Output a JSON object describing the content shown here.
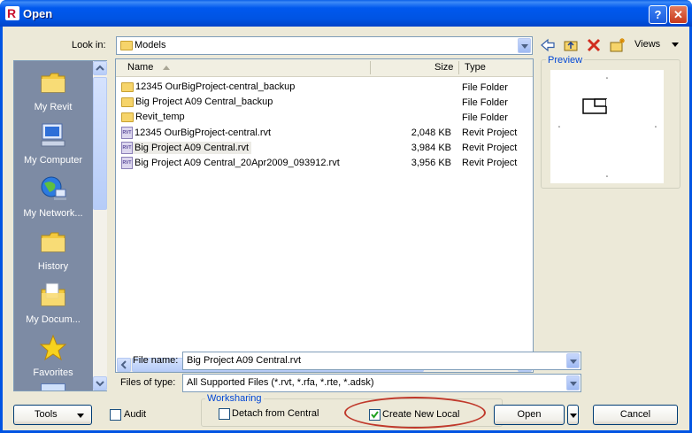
{
  "window": {
    "title": "Open",
    "help_glyph": "?",
    "close_glyph": "✕"
  },
  "look_in": {
    "label": "Look in:",
    "value": "Models"
  },
  "toolbar": {
    "back_icon": "back-arrow-icon",
    "up_icon": "up-folder-icon",
    "delete_icon": "delete-icon",
    "new_folder_icon": "new-folder-icon",
    "views_label": "Views"
  },
  "places": [
    {
      "label": "My Revit",
      "icon": "folder-icon"
    },
    {
      "label": "My Computer",
      "icon": "computer-icon"
    },
    {
      "label": "My Network...",
      "icon": "network-icon"
    },
    {
      "label": "History",
      "icon": "folder-icon"
    },
    {
      "label": "My Docum...",
      "icon": "documents-icon"
    },
    {
      "label": "Favorites",
      "icon": "star-icon"
    }
  ],
  "file_list": {
    "columns": [
      "Name",
      "Size",
      "Type"
    ],
    "rows": [
      {
        "name": "12345 OurBigProject-central_backup",
        "size": "",
        "type": "File Folder",
        "icon": "folder"
      },
      {
        "name": "Big Project A09 Central_backup",
        "size": "",
        "type": "File Folder",
        "icon": "folder"
      },
      {
        "name": "Revit_temp",
        "size": "",
        "type": "File Folder",
        "icon": "folder"
      },
      {
        "name": "12345 OurBigProject-central.rvt",
        "size": "2,048 KB",
        "type": "Revit Project",
        "icon": "rvt"
      },
      {
        "name": "Big Project A09 Central.rvt",
        "size": "3,984 KB",
        "type": "Revit Project",
        "icon": "rvt",
        "selected": true
      },
      {
        "name": "Big Project A09 Central_20Apr2009_093912.rvt",
        "size": "3,956 KB",
        "type": "Revit Project",
        "icon": "rvt"
      }
    ]
  },
  "preview": {
    "label": "Preview"
  },
  "file_name": {
    "label": "File name:",
    "value": "Big Project A09 Central.rvt"
  },
  "files_of_type": {
    "label": "Files of type:",
    "value": "All Supported Files  (*.rvt,  *.rfa,  *.rte,  *.adsk)"
  },
  "tools_button": "Tools",
  "audit": {
    "label": "Audit",
    "checked": false
  },
  "worksharing": {
    "group_label": "Worksharing",
    "detach_label": "Detach from Central",
    "detach_checked": false,
    "create_local_label": "Create New Local",
    "create_local_checked": true
  },
  "open_button": "Open",
  "cancel_button": "Cancel",
  "colors": {
    "titlebar": "#0054e3",
    "dialog_bg": "#ece9d8",
    "places_bg": "#7d8ba4",
    "highlight_ring": "#c0392b"
  }
}
